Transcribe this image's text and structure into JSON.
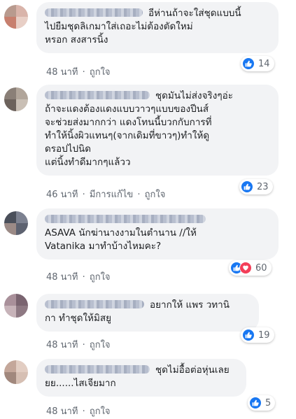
{
  "colors": {
    "like_blue": "#1877f2",
    "love_red": "#f33e58",
    "bubble_bg": "#f2f3f5",
    "meta_gray": "#606770"
  },
  "comments": [
    {
      "text_lines": [
        "อีห่านถ้าจะใส่ชุดแบบนี้",
        "ไปยืมชุดลิเกมาใส่เถอะไม่ต้องตัดใหม่",
        "หรอก สงสารนิ้ง"
      ],
      "time": "48 นาที",
      "like_label": "ถูกใจ",
      "reaction_count": "14"
    },
    {
      "text_lines": [
        "ชุดมันไม่ส่งจริงๆอ่ะ",
        "ถ้าจะแดงต้องแดงแบบวาวๆแบบของปีนส์",
        "จะช่วยส่งมากกว่า แดงโทนนี้บวกกับการที่",
        "ทำให้นิ้งผิวแทนๆ(จากเดิมที่ขาวๆ)ทำให้ดู",
        "ดรอปไปนิด",
        "แต่นิ้งทำดีมากๆแล้วว"
      ],
      "time": "46 นาที",
      "edited_label": "มีการแก้ไข",
      "like_label": "ถูกใจ",
      "reaction_count": "23"
    },
    {
      "text_lines": [
        "ASAVA นักฆ่านางงามในตำนาน //ให้",
        "Vatanika มาทำบ้างไหมคะ?"
      ],
      "time": "48 นาที",
      "like_label": "ถูกใจ",
      "reaction_count": "60"
    },
    {
      "text_lines": [
        "อยากให้ แพร วทานิ",
        "กา ทำชุดให้มิสยู"
      ],
      "time": "48 นาที",
      "like_label": "ถูกใจ",
      "reaction_count": "19"
    },
    {
      "text_lines": [
        "ชุดไม่อื้อต่อหุ่นเลย",
        "ยย......ไสเจียมาก"
      ],
      "time": "48 นาที",
      "like_label": "ถูกใจ",
      "reaction_count": "5"
    }
  ]
}
